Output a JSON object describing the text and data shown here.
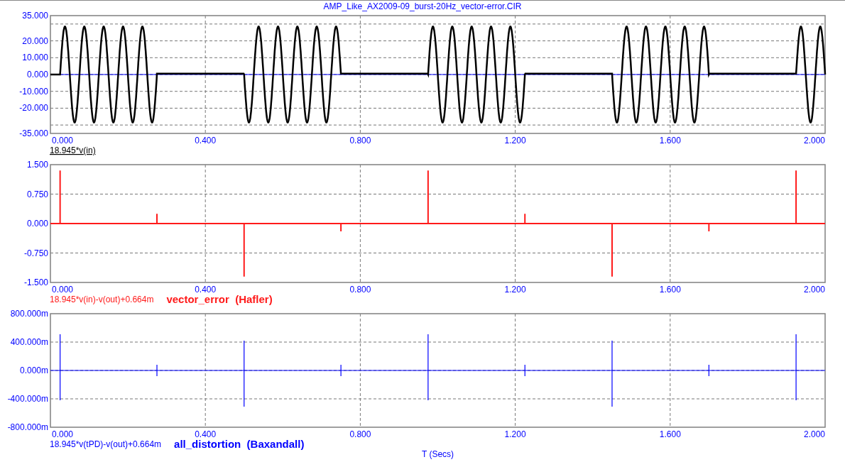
{
  "title": "AMP_Like_AX2009-09_burst-20Hz_vector-error.CIR",
  "plots": [
    {
      "kind": "sine-burst",
      "color": "#000000",
      "y_ticks": [
        "35.000",
        "20.000",
        "10.000",
        "0.000",
        "-10.000",
        "-20.000",
        "-35.000"
      ],
      "x_ticks": [
        "0.000",
        "0.400",
        "0.800",
        "1.200",
        "1.600",
        "2.000"
      ],
      "trace_label": "18.945*v(in)"
    },
    {
      "kind": "error-spikes",
      "color": "#ff1a1a",
      "y_ticks": [
        "1.500",
        "0.750",
        "0.000",
        "-0.750",
        "-1.500"
      ],
      "x_ticks": [
        "0.000",
        "0.400",
        "0.800",
        "1.200",
        "1.600",
        "2.000"
      ],
      "trace_label": "18.945*v(in)-v(out)+0.664m",
      "caption": "vector_error  (Hafler)"
    },
    {
      "kind": "distortion-spikes",
      "color": "#0000ff",
      "y_ticks": [
        "800.000m",
        "400.000m",
        "0.000m",
        "-400.000m",
        "-800.000m"
      ],
      "x_ticks": [
        "0.000",
        "0.400",
        "0.800",
        "1.200",
        "1.600",
        "2.000"
      ],
      "trace_label": "18.945*v(tPD)-v(out)+0.664m",
      "caption": "all_distortion  (Baxandall)"
    }
  ],
  "x_axis_title": "T (Secs)"
}
